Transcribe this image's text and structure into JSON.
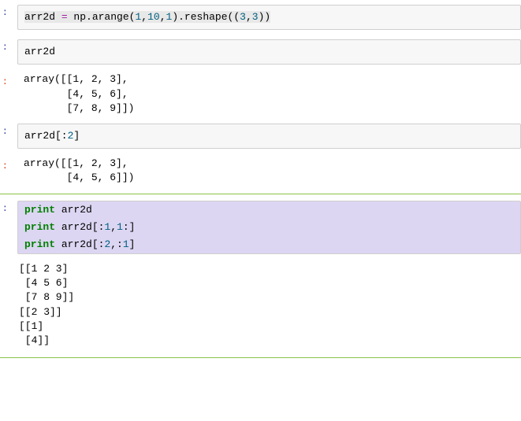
{
  "cells": [
    {
      "type": "input",
      "prompt": ":",
      "code_html": "<span class=\"sel\">arr2d <span class=\"op\">=</span> np.arange(<span class=\"num\">1</span>,<span class=\"num\">10</span>,<span class=\"num\">1</span>).reshape((<span class=\"num\">3</span>,<span class=\"num\">3</span>))</span>"
    },
    {
      "type": "input",
      "prompt": ":",
      "code_html": "arr2d"
    },
    {
      "type": "output",
      "prompt": ":",
      "text": "array([[1, 2, 3],\n       [4, 5, 6],\n       [7, 8, 9]])"
    },
    {
      "type": "input",
      "prompt": ":",
      "code_html": "arr2d[:<span class=\"num\">2</span>]"
    },
    {
      "type": "output",
      "prompt": ":",
      "text": "array([[1, 2, 3],\n       [4, 5, 6]])"
    },
    {
      "type": "divider"
    },
    {
      "type": "input_hl",
      "prompt": ":",
      "lines": [
        "<span class=\"kw\">print</span> arr2d",
        "<span class=\"kw\">print</span> arr2d[:<span class=\"num\">1</span>,<span class=\"num\">1</span>:]",
        "<span class=\"kw\">print</span> arr2d[:<span class=\"num\">2</span>,:<span class=\"num\">1</span>]"
      ]
    },
    {
      "type": "output_plain",
      "text": "[[1 2 3]\n [4 5 6]\n [7 8 9]]\n[[2 3]]\n[[1]\n [4]]"
    },
    {
      "type": "divider2"
    }
  ]
}
